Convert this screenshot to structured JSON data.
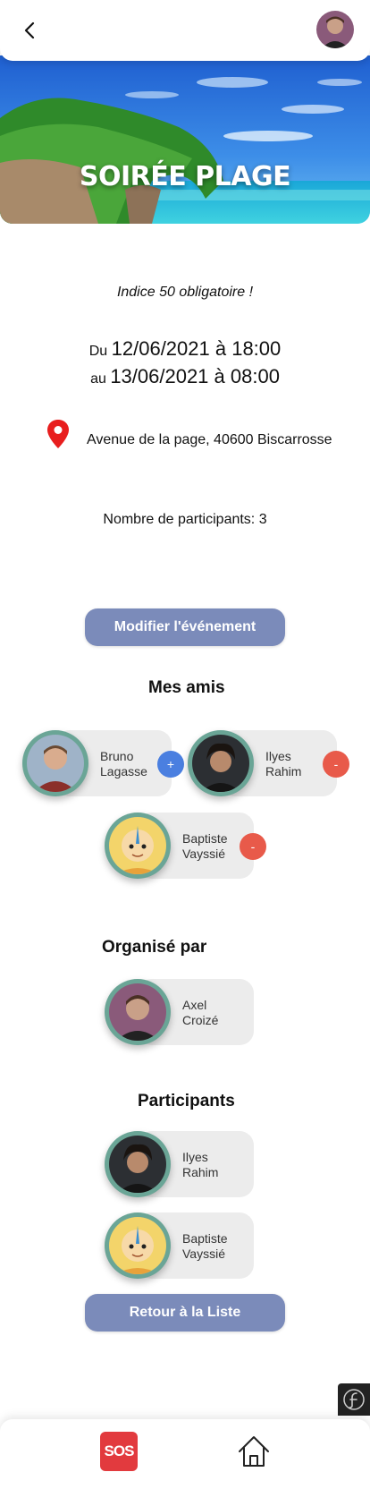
{
  "event": {
    "title": "SOIRÉE PLAGE",
    "note": "Indice 50 obligatoire !",
    "from_prefix": "Du",
    "from_value": "12/06/2021 à 18:00",
    "to_prefix": "au",
    "to_value": "13/06/2021 à 08:00",
    "location": "Avenue de la page, 40600 Biscarrosse",
    "participants_count": "Nombre de participants: 3"
  },
  "actions": {
    "edit_label": "Modifier l'événement",
    "back_to_list_label": "Retour à la Liste"
  },
  "friends": {
    "title": "Mes amis",
    "items": [
      {
        "first": "Bruno",
        "last": "Lagasse",
        "action": "+"
      },
      {
        "first": "Ilyes",
        "last": "Rahim",
        "action": "-"
      },
      {
        "first": "Baptiste",
        "last": "Vayssié",
        "action": "-"
      }
    ]
  },
  "organizer": {
    "title": "Organisé par",
    "first": "Axel",
    "last": "Croizé"
  },
  "participants": {
    "title": "Participants",
    "items": [
      {
        "first": "Ilyes",
        "last": "Rahim"
      },
      {
        "first": "Baptiste",
        "last": "Vayssié"
      }
    ]
  },
  "bottom_nav": {
    "sos_label": "SOS",
    "icons": [
      "sos-icon",
      "home-icon"
    ]
  },
  "colors": {
    "button": "#7b8bba",
    "avatar_ring": "#6aa596",
    "add": "#4a7fe0",
    "remove": "#e85a4a",
    "pin": "#e81e1e",
    "sos": "#e23a3e"
  }
}
